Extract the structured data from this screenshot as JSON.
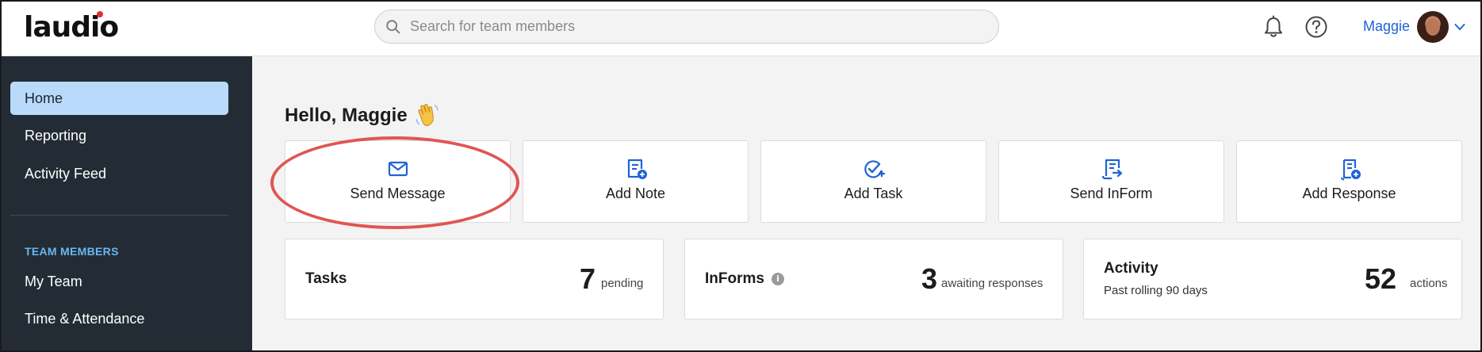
{
  "header": {
    "logo": "laudio",
    "search_placeholder": "Search for team members",
    "user_name": "Maggie"
  },
  "sidebar": {
    "items": [
      {
        "label": "Home",
        "active": true
      },
      {
        "label": "Reporting"
      },
      {
        "label": "Activity Feed"
      }
    ],
    "section_title": "TEAM MEMBERS",
    "team_items": [
      {
        "label": "My Team"
      },
      {
        "label": "Time & Attendance"
      }
    ]
  },
  "main": {
    "greeting": "Hello, Maggie",
    "actions": [
      {
        "label": "Send Message",
        "icon": "envelope-icon"
      },
      {
        "label": "Add Note",
        "icon": "add-note-icon"
      },
      {
        "label": "Add Task",
        "icon": "add-task-icon"
      },
      {
        "label": "Send InForm",
        "icon": "send-inform-icon"
      },
      {
        "label": "Add Response",
        "icon": "add-response-icon"
      }
    ],
    "stats": {
      "tasks": {
        "title": "Tasks",
        "value": "7",
        "unit": "pending"
      },
      "informs": {
        "title": "InForms",
        "value": "3",
        "unit": "awaiting responses"
      },
      "activity": {
        "title": "Activity",
        "subtitle": "Past rolling 90 days",
        "value": "52",
        "unit": "actions"
      }
    }
  },
  "colors": {
    "accent": "#1f63d6",
    "sidebar_bg": "#232c35",
    "active_nav": "#b9dafb",
    "highlight": "#e05554"
  }
}
